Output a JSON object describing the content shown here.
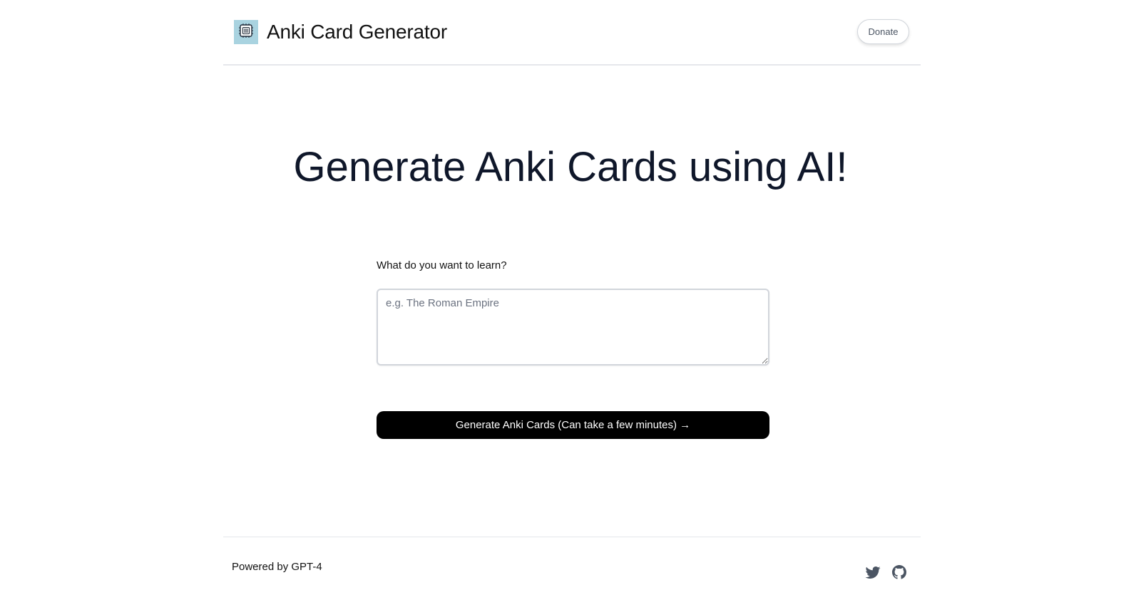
{
  "header": {
    "app_title": "Anki Card Generator",
    "logo_icon": "circuit-brain-icon",
    "donate_label": "Donate"
  },
  "main": {
    "headline": "Generate Anki Cards using AI!",
    "prompt_label": "What do you want to learn?",
    "topic_input": {
      "value": "",
      "placeholder": "e.g. The Roman Empire"
    },
    "generate_button_label": "Generate Anki Cards (Can take a few minutes) →"
  },
  "footer": {
    "powered_by": "Powered by GPT-4",
    "social_icons": [
      "twitter-icon",
      "github-icon"
    ]
  },
  "colors": {
    "button_bg": "#000000",
    "heading": "#0f172a",
    "icon_gray": "#4b5563",
    "logo_bg": "#a9d3e0"
  }
}
